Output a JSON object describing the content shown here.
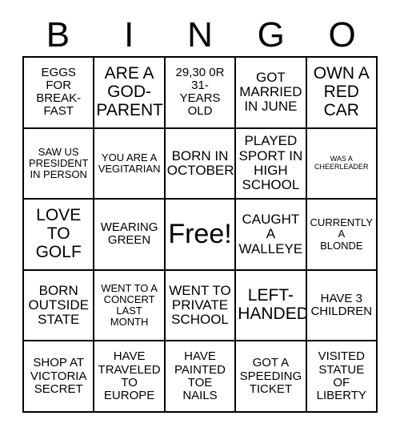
{
  "header": {
    "letters": [
      "B",
      "I",
      "N",
      "G",
      "O"
    ]
  },
  "grid": {
    "rows": 5,
    "columns": 5,
    "border_color": "#000000",
    "background_color": "#ffffff",
    "text_color": "#000000",
    "cells": [
      {
        "text": "EGGS\nFOR\nBREAK-\nFAST",
        "size": "fs-sm",
        "free": false
      },
      {
        "text": "ARE A\nGOD-\nPARENT",
        "size": "fs-lg",
        "free": false
      },
      {
        "text": "29,30 0R\n31-\nYEARS\nOLD",
        "size": "fs-sm",
        "free": false
      },
      {
        "text": "GOT\nMARRIED\nIN JUNE",
        "size": "fs-md",
        "free": false
      },
      {
        "text": "OWN A\nRED\nCAR",
        "size": "fs-lg",
        "free": false
      },
      {
        "text": "SAW US\nPRESIDENT\nIN PERSON",
        "size": "fs-xs",
        "free": false
      },
      {
        "text": "YOU ARE A\nVEGITARIAN",
        "size": "fs-xs",
        "free": false
      },
      {
        "text": "BORN IN\nOCTOBER",
        "size": "fs-md",
        "free": false
      },
      {
        "text": "PLAYED\nSPORT IN\nHIGH\nSCHOOL",
        "size": "fs-md",
        "free": false
      },
      {
        "text": "WAS A\nCHEERLEADER",
        "size": "fs-tiny",
        "free": false
      },
      {
        "text": "LOVE\nTO\nGOLF",
        "size": "fs-lg",
        "free": false
      },
      {
        "text": "WEARING\nGREEN",
        "size": "fs-sm",
        "free": false
      },
      {
        "text": "Free!",
        "size": "fs-xl",
        "free": true
      },
      {
        "text": "CAUGHT\nA\nWALLEYE",
        "size": "fs-md",
        "free": false
      },
      {
        "text": "CURRENTLY\nA\nBLONDE",
        "size": "fs-xs",
        "free": false
      },
      {
        "text": "BORN\nOUTSIDE\nSTATE",
        "size": "fs-md",
        "free": false
      },
      {
        "text": "WENT TO A\nCONCERT\nLAST\nMONTH",
        "size": "fs-xs",
        "free": false
      },
      {
        "text": "WENT TO\nPRIVATE\nSCHOOL",
        "size": "fs-md",
        "free": false
      },
      {
        "text": "LEFT-\nHANDED",
        "size": "fs-lg",
        "free": false
      },
      {
        "text": "HAVE 3\nCHILDREN",
        "size": "fs-sm",
        "free": false
      },
      {
        "text": "SHOP AT\nVICTORIA\nSECRET",
        "size": "fs-sm",
        "free": false
      },
      {
        "text": "HAVE\nTRAVELED\nTO\nEUROPE",
        "size": "fs-sm",
        "free": false
      },
      {
        "text": "HAVE\nPAINTED\nTOE\nNAILS",
        "size": "fs-sm",
        "free": false
      },
      {
        "text": "GOT A\nSPEEDING\nTICKET",
        "size": "fs-sm",
        "free": false
      },
      {
        "text": "VISITED\nSTATUE\nOF\nLIBERTY",
        "size": "fs-sm",
        "free": false
      }
    ]
  }
}
